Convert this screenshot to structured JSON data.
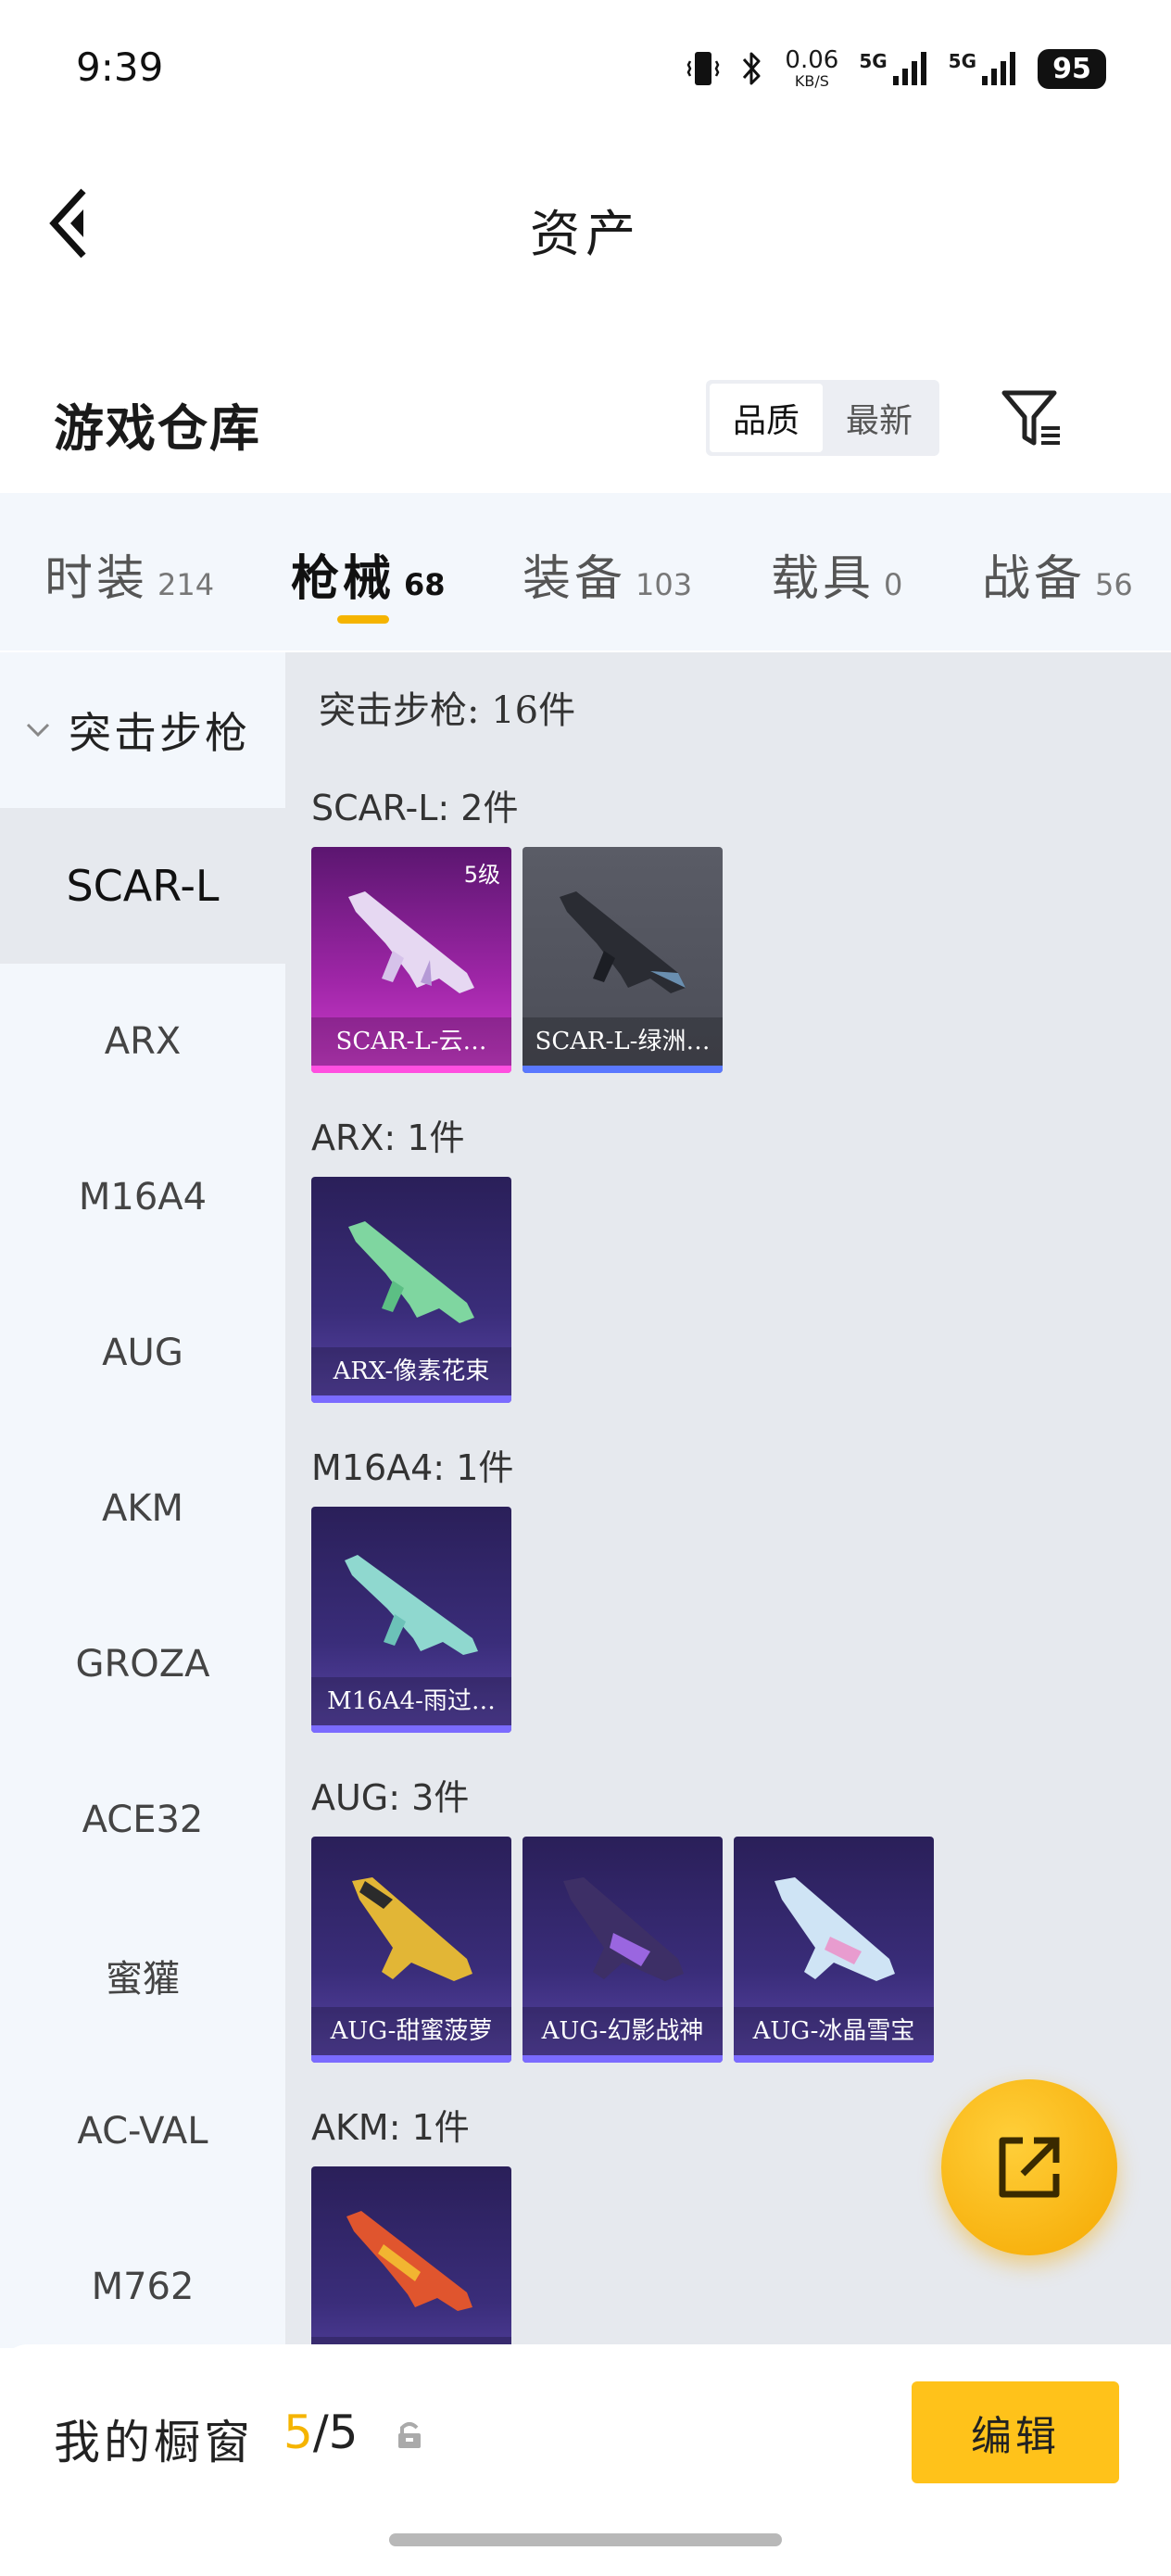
{
  "status_bar": {
    "time": "9:39",
    "net_speed_value": "0.06",
    "net_speed_unit": "KB/S",
    "signal_1_label": "5G",
    "signal_2_label": "5G",
    "battery": "95"
  },
  "header": {
    "title": "资产",
    "back_icon": "back-arrow-icon"
  },
  "warehouse": {
    "title": "游戏仓库",
    "sort_options": [
      "品质",
      "最新"
    ],
    "selected_sort": "品质",
    "filter_icon": "filter-icon"
  },
  "tabs": [
    {
      "label": "时装",
      "count": "214"
    },
    {
      "label": "枪械",
      "count": "68"
    },
    {
      "label": "装备",
      "count": "103"
    },
    {
      "label": "载具",
      "count": "0"
    },
    {
      "label": "战备",
      "count": "56"
    }
  ],
  "active_tab": "枪械",
  "sidebar": {
    "group_label": "突击步枪",
    "items": [
      "SCAR-L",
      "ARX",
      "M16A4",
      "AUG",
      "AKM",
      "GROZA",
      "ACE32",
      "蜜獾",
      "AC-VAL",
      "M762"
    ],
    "selected": "SCAR-L"
  },
  "content": {
    "group_title": "突击步枪: 16件",
    "sections": [
      {
        "title": "SCAR-L: 2件",
        "items": [
          {
            "name": "SCAR-L-云…",
            "level": "5级",
            "rarity": "pink"
          },
          {
            "name": "SCAR-L-绿洲…",
            "level": "",
            "rarity": "gray"
          }
        ]
      },
      {
        "title": "ARX: 1件",
        "items": [
          {
            "name": "ARX-像素花束",
            "level": "",
            "rarity": "purple"
          }
        ]
      },
      {
        "title": "M16A4: 1件",
        "items": [
          {
            "name": "M16A4-雨过…",
            "level": "",
            "rarity": "purple"
          }
        ]
      },
      {
        "title": "AUG: 3件",
        "items": [
          {
            "name": "AUG-甜蜜菠萝",
            "level": "",
            "rarity": "purple"
          },
          {
            "name": "AUG-幻影战神",
            "level": "",
            "rarity": "purple"
          },
          {
            "name": "AUG-冰晶雪宝",
            "level": "",
            "rarity": "purple"
          }
        ]
      },
      {
        "title": "AKM: 1件",
        "items": [
          {
            "name": "",
            "level": "",
            "rarity": "purple"
          }
        ]
      }
    ]
  },
  "fab": {
    "icon": "share-external-icon"
  },
  "bottom_bar": {
    "showcase_label": "我的橱窗",
    "showcase_current": "5",
    "showcase_total": "/5",
    "lock_icon": "lock-icon",
    "edit_label": "编辑"
  },
  "colors": {
    "accent": "#f5b400",
    "edit_button": "#ffc21a",
    "sidebar_bg": "#f3f7fc",
    "content_bg": "#e6e9ee"
  }
}
